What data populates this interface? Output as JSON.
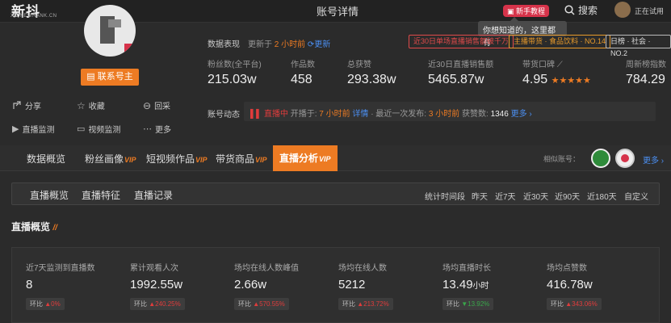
{
  "header": {
    "logo": "新抖",
    "logo_sub": "XD.NEWRANK.CN",
    "page_title": "账号详情",
    "new_tutorial": "新手教程",
    "search": "搜索",
    "trial": "正在试用",
    "tooltip": "你想知道的，这里都有"
  },
  "account": {
    "contact_button": "联系号主",
    "actions": [
      "分享",
      "收藏",
      "回采",
      "直播监测",
      "视频监测",
      "更多"
    ]
  },
  "data_overview": {
    "label": "数据表现",
    "updated_prefix": "更新于",
    "updated_value": "2 小时前",
    "refresh": "更新"
  },
  "tags": [
    {
      "text": "近30日单场直播销售额破千万",
      "color": "#e04a4a"
    },
    {
      "text": "主播带货 · 食品饮料 · NO.14",
      "color": "#e89a2a"
    },
    {
      "text": "日榜 · 社会 · NO.2",
      "color": "#bbbbbb"
    }
  ],
  "metrics": [
    {
      "label": "粉丝数(全平台)",
      "value": "215.03w"
    },
    {
      "label": "作品数",
      "value": "458"
    },
    {
      "label": "总获赞",
      "value": "293.38w"
    },
    {
      "label": "近30日直播销售额",
      "value": "5465.87w"
    },
    {
      "label": "带货口碑",
      "value": "4.95"
    },
    {
      "label": "周新榜指数",
      "value": "784.29"
    }
  ],
  "dynamic": {
    "label": "账号动态",
    "live": "直播中",
    "started_prefix": "开播于:",
    "started_value": "7 小时前",
    "detail": "详情",
    "last_pub_prefix": "· 最近一次发布:",
    "last_pub_value": "3 小时前",
    "likes_prefix": "获赞数:",
    "likes_value": "1346",
    "more": "更多"
  },
  "tabs": [
    {
      "label": "数据概览",
      "vip": ""
    },
    {
      "label": "粉丝画像",
      "vip": "VIP"
    },
    {
      "label": "短视频作品",
      "vip": "VIP"
    },
    {
      "label": "带货商品",
      "vip": "VIP"
    },
    {
      "label": "直播分析",
      "vip": "VIP"
    }
  ],
  "similar": {
    "label": "相似账号：",
    "more": "更多"
  },
  "subtabs": [
    "直播概览",
    "直播特征",
    "直播记录"
  ],
  "period": {
    "label": "统计时间段",
    "options": [
      "昨天",
      "近7天",
      "近30天",
      "近90天",
      "近180天",
      "自定义"
    ],
    "active": "近7天"
  },
  "section_title": "直播概览",
  "stats": [
    {
      "label": "近7天监测到直播数",
      "value": "8",
      "unit": "",
      "ring_label": "环比",
      "ring": "0%",
      "dir": "up"
    },
    {
      "label": "累计观看人次",
      "value": "1992.55w",
      "unit": "",
      "ring_label": "环比",
      "ring": "240.25%",
      "dir": "up"
    },
    {
      "label": "场均在线人数峰值",
      "value": "2.66w",
      "unit": "",
      "ring_label": "环比",
      "ring": "570.55%",
      "dir": "up"
    },
    {
      "label": "场均在线人数",
      "value": "5212",
      "unit": "",
      "ring_label": "环比",
      "ring": "213.72%",
      "dir": "up"
    },
    {
      "label": "场均直播时长",
      "value": "13.49",
      "unit": "小时",
      "ring_label": "环比",
      "ring": "13.92%",
      "dir": "down"
    },
    {
      "label": "场均点赞数",
      "value": "416.78w",
      "unit": "",
      "ring_label": "环比",
      "ring": "343.06%",
      "dir": "up"
    }
  ]
}
